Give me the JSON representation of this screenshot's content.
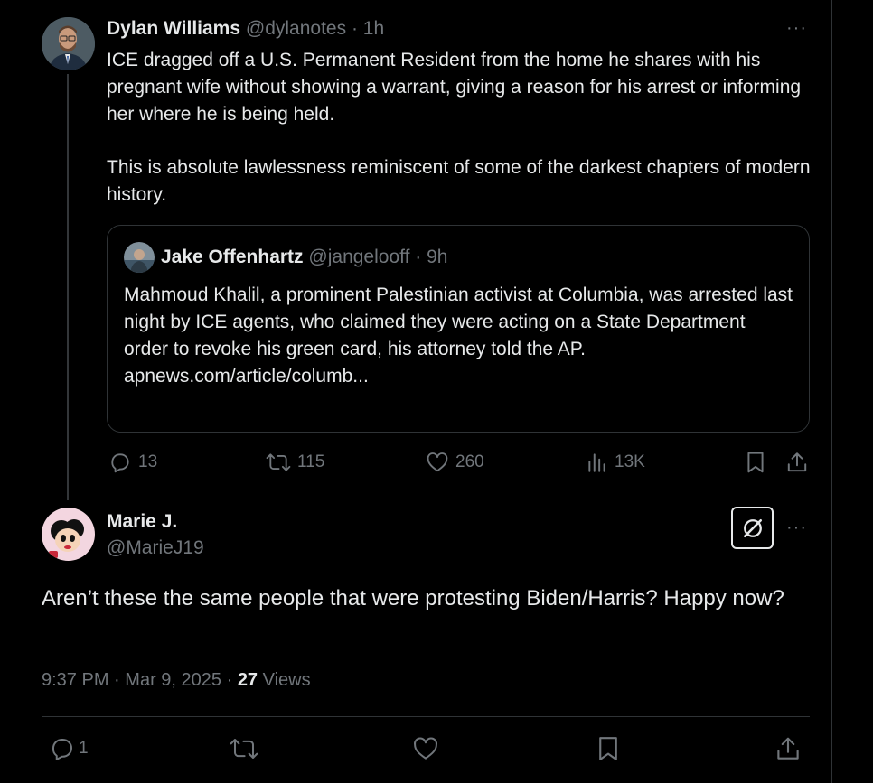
{
  "original_post": {
    "author_name": "Dylan Williams",
    "handle": "@dylanotes",
    "separator": "·",
    "time": "1h",
    "more_label": "···",
    "text_p1": "ICE dragged off a U.S. Permanent Resident from the home he shares with his pregnant wife without showing a warrant, giving a reason for his arrest or informing her where he is being held.",
    "text_p2": "This is absolute lawlessness reminiscent of some of the darkest chapters of modern history.",
    "quote": {
      "author_name": "Jake Offenhartz",
      "handle": "@jangelooff",
      "separator": "·",
      "time": "9h",
      "text": "Mahmoud Khalil, a prominent Palestinian activist at Columbia, was arrested last night by ICE agents, who claimed they were acting on a State Department order to revoke his green card, his attorney told the AP.",
      "link": "apnews.com/article/columb..."
    },
    "actions": {
      "replies": "13",
      "reposts": "115",
      "likes": "260",
      "views": "13K"
    }
  },
  "reply_post": {
    "author_name": "Marie J.",
    "handle": "@MarieJ19",
    "more_label": "···",
    "text": "Aren’t these the same people that were protesting Biden/Harris?  Happy now?",
    "meta": {
      "time": "9:37 PM",
      "separator": "·",
      "date": "Mar 9, 2025",
      "views_count": "27",
      "views_label": "Views"
    },
    "actions": {
      "replies": "1"
    }
  },
  "icons": {
    "reply": "reply-icon",
    "repost": "repost-icon",
    "like": "heart-icon",
    "views": "views-icon",
    "bookmark": "bookmark-icon",
    "share": "share-icon",
    "grok": "grok-icon",
    "more": "more-icon"
  },
  "colors": {
    "background": "#000000",
    "text": "#e7e9ea",
    "muted": "#71767b",
    "border": "#2f3336"
  }
}
